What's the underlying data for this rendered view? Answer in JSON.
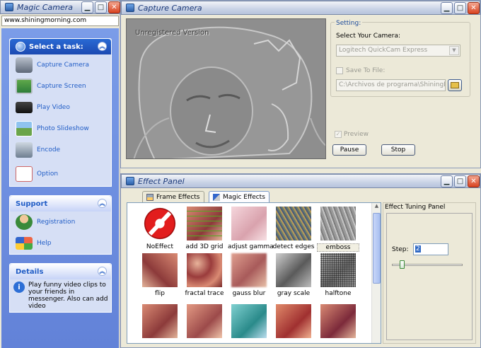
{
  "left_window": {
    "title": "Magic Camera",
    "url": "www.shiningmorning.com",
    "tasks_title": "Select a task:",
    "tasks": [
      {
        "label": "Capture Camera",
        "icon": "camera-icon"
      },
      {
        "label": "Capture Screen",
        "icon": "monitor-icon"
      },
      {
        "label": "Play Video",
        "icon": "film-icon"
      },
      {
        "label": "Photo Slideshow",
        "icon": "landscape-icon"
      },
      {
        "label": "Encode",
        "icon": "encode-icon"
      },
      {
        "label": "Option",
        "icon": "option-icon"
      }
    ],
    "support_title": "Support",
    "support": [
      {
        "label": "Registration",
        "icon": "user-icon"
      },
      {
        "label": "Help",
        "icon": "help-icon"
      }
    ],
    "details_title": "Details",
    "details_text": "Play funny video clips to your friends in messenger. Also can add video"
  },
  "capture_window": {
    "title": "Capture Camera",
    "watermark": "Unregistered Version",
    "setting_title": "Setting:",
    "camera_label": "Select Your Camera:",
    "camera_value": "Logitech QuickCam Express",
    "save_to_file_label": "Save To File:",
    "save_path": "C:\\Archivos de programa\\ShiningMorn",
    "preview_label": "Preview",
    "pause_label": "Pause",
    "stop_label": "Stop"
  },
  "effect_window": {
    "title": "Effect Panel",
    "tabs": [
      {
        "label": "Frame Effects",
        "icon": "frame-effects-icon"
      },
      {
        "label": "Magic Effects",
        "icon": "magic-effects-icon"
      }
    ],
    "effects_row1": [
      "NoEffect",
      "add 3D grid",
      "adjust gamma",
      "detect edges",
      "emboss"
    ],
    "effects_row2": [
      "flip",
      "fractal trace",
      "gauss blur",
      "gray scale",
      "halftone"
    ],
    "tuning_title": "Effect Tuning Panel",
    "step_label": "Step:",
    "step_value": "2",
    "slider_level": 0.12
  },
  "colors": {
    "accent": "#215dc6",
    "title_text": "#1c3a7a",
    "window_bg": "#ece9d8"
  }
}
